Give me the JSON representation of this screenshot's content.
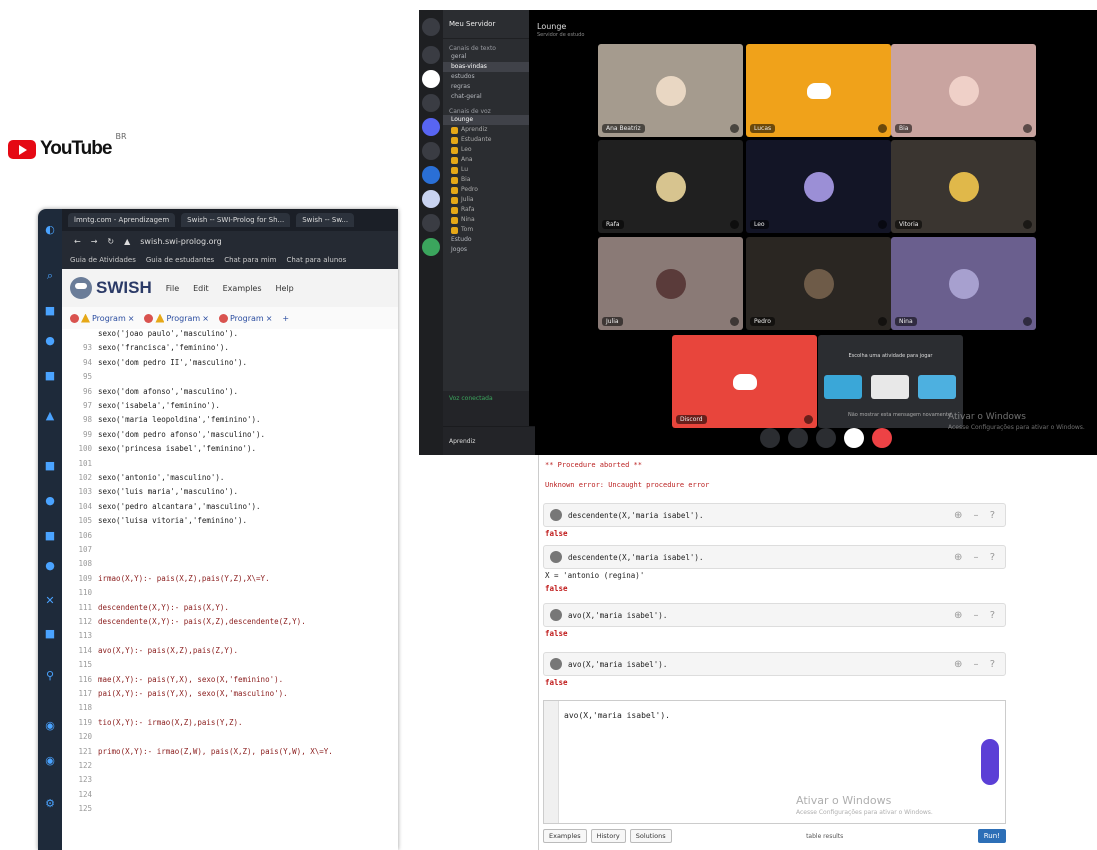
{
  "youtube": {
    "wordmark": "YouTube",
    "region": "BR"
  },
  "swish": {
    "tabs": [
      "lmntg.com - Aprendizagem",
      "Swish -- SWI-Prolog for Sh...",
      "Swish -- Sw..."
    ],
    "address": "swish.swi-prolog.org",
    "bookmarks": [
      "Guia de Atividades",
      "Guia de estudantes",
      "Chat para mim",
      "Chat para alunos"
    ],
    "logo": "SWISH",
    "menu": [
      "File",
      "Edit",
      "Examples",
      "Help"
    ],
    "program_tabs": [
      "Program",
      "Program",
      "Program"
    ],
    "code": [
      {
        "n": "",
        "t": "sexo('joao paulo','masculino')."
      },
      {
        "n": "93",
        "t": "sexo('francisca','feminino')."
      },
      {
        "n": "94",
        "t": "sexo('dom pedro II','masculino')."
      },
      {
        "n": "95",
        "t": ""
      },
      {
        "n": "96",
        "t": "sexo('dom afonso','masculino')."
      },
      {
        "n": "97",
        "t": "sexo('isabela','feminino')."
      },
      {
        "n": "98",
        "t": "sexo('maria leopoldina','feminino')."
      },
      {
        "n": "99",
        "t": "sexo('dom pedro afonso','masculino')."
      },
      {
        "n": "100",
        "t": "sexo('princesa isabel','feminino')."
      },
      {
        "n": "101",
        "t": ""
      },
      {
        "n": "102",
        "t": "sexo('antonio','masculino')."
      },
      {
        "n": "103",
        "t": "sexo('luis maria','masculino')."
      },
      {
        "n": "104",
        "t": "sexo('pedro alcantara','masculino')."
      },
      {
        "n": "105",
        "t": "sexo('luisa vitoria','feminino')."
      },
      {
        "n": "106",
        "t": ""
      },
      {
        "n": "107",
        "t": ""
      },
      {
        "n": "108",
        "t": ""
      },
      {
        "n": "109",
        "t": "irmao(X,Y):- pais(X,Z),pais(Y,Z),X\\=Y."
      },
      {
        "n": "110",
        "t": ""
      },
      {
        "n": "111",
        "t": "descendente(X,Y):- pais(X,Y)."
      },
      {
        "n": "112",
        "t": "descendente(X,Y):- pais(X,Z),descendente(Z,Y)."
      },
      {
        "n": "113",
        "t": ""
      },
      {
        "n": "114",
        "t": "avo(X,Y):- pais(X,Z),pais(Z,Y)."
      },
      {
        "n": "115",
        "t": ""
      },
      {
        "n": "116",
        "t": "mae(X,Y):- pais(Y,X), sexo(X,'feminino')."
      },
      {
        "n": "117",
        "t": "pai(X,Y):- pais(Y,X), sexo(X,'masculino')."
      },
      {
        "n": "118",
        "t": ""
      },
      {
        "n": "119",
        "t": "tio(X,Y):- irmao(X,Z),pais(Y,Z)."
      },
      {
        "n": "120",
        "t": ""
      },
      {
        "n": "121",
        "t": "primo(X,Y):- irmao(Z,W), pais(X,Z), pais(Y,W), X\\=Y."
      },
      {
        "n": "122",
        "t": ""
      },
      {
        "n": "123",
        "t": ""
      },
      {
        "n": "124",
        "t": ""
      },
      {
        "n": "125",
        "t": ""
      }
    ]
  },
  "discord": {
    "server_name": "Meu Servidor",
    "channel_title": "Lounge",
    "channel_topic": "Servidor de estudo",
    "categories": [
      "Canais de texto",
      "Canais de voz"
    ],
    "text_channels": [
      "geral",
      "boas-vindas",
      "estudos",
      "regras",
      "chat-geral"
    ],
    "voice_channels": [
      "Lounge",
      "Estudo",
      "Jogos"
    ],
    "voice_users": [
      "Aprendiz",
      "Estudante",
      "Leo",
      "Ana",
      "Lu",
      "Bia",
      "Pedro",
      "Julia",
      "Rafa",
      "Nina",
      "Tom"
    ],
    "voice_status": "Voz conectada",
    "me": "Aprendiz",
    "tiles": [
      {
        "name": "Ana Beatriz",
        "bg": "#a59b8e",
        "av": "#e9d7c3"
      },
      {
        "name": "Lucas",
        "bg": "#f0a21a",
        "av": "#ffffff",
        "logo": true
      },
      {
        "name": "Bia",
        "bg": "#c9a4a0",
        "av": "#efd0c8"
      },
      {
        "name": "Rafa",
        "bg": "#202020",
        "av": "#d7c48f"
      },
      {
        "name": "Leo",
        "bg": "#131526",
        "av": "#9b8fd6"
      },
      {
        "name": "Vitoria",
        "bg": "#3a3530",
        "av": "#e0b84a"
      },
      {
        "name": "Julia",
        "bg": "#8a7a76",
        "av": "#5a3b3a"
      },
      {
        "name": "Pedro",
        "bg": "#2a2622",
        "av": "#6e5b48"
      },
      {
        "name": "Nina",
        "bg": "#6a5f8e",
        "av": "#a7a0cf"
      },
      {
        "name": "Discord",
        "bg": "#e8453c",
        "av": "#ffffff",
        "logo": true
      }
    ],
    "promo_text": "Escolha uma atividade para jogar",
    "promo_sub": "Não mostrar esta mensagem novamente",
    "activation_title": "Ativar o Windows",
    "activation_sub": "Acesse Configurações para ativar o Windows."
  },
  "query": {
    "warning1": "** Procedure aborted **",
    "warning2": "Unknown error: Uncaught procedure error",
    "items": [
      {
        "q": "descendente(X,'maria isabel').",
        "result": "false",
        "answer": ""
      },
      {
        "q": "descendente(X,'maria isabel').",
        "result": "false",
        "answer": "X = 'antonio (regina)'"
      },
      {
        "q": "avo(X,'maria isabel').",
        "result": "false",
        "answer": ""
      },
      {
        "q": "avo(X,'maria isabel').",
        "result": "false",
        "answer": ""
      }
    ],
    "input": "avo(X,'maria isabel').",
    "buttons": [
      "Examples",
      "History",
      "Solutions"
    ],
    "table_results": "table results",
    "run": "Run!",
    "activation_title": "Ativar o Windows",
    "activation_sub": "Acesse Configurações para ativar o Windows."
  }
}
